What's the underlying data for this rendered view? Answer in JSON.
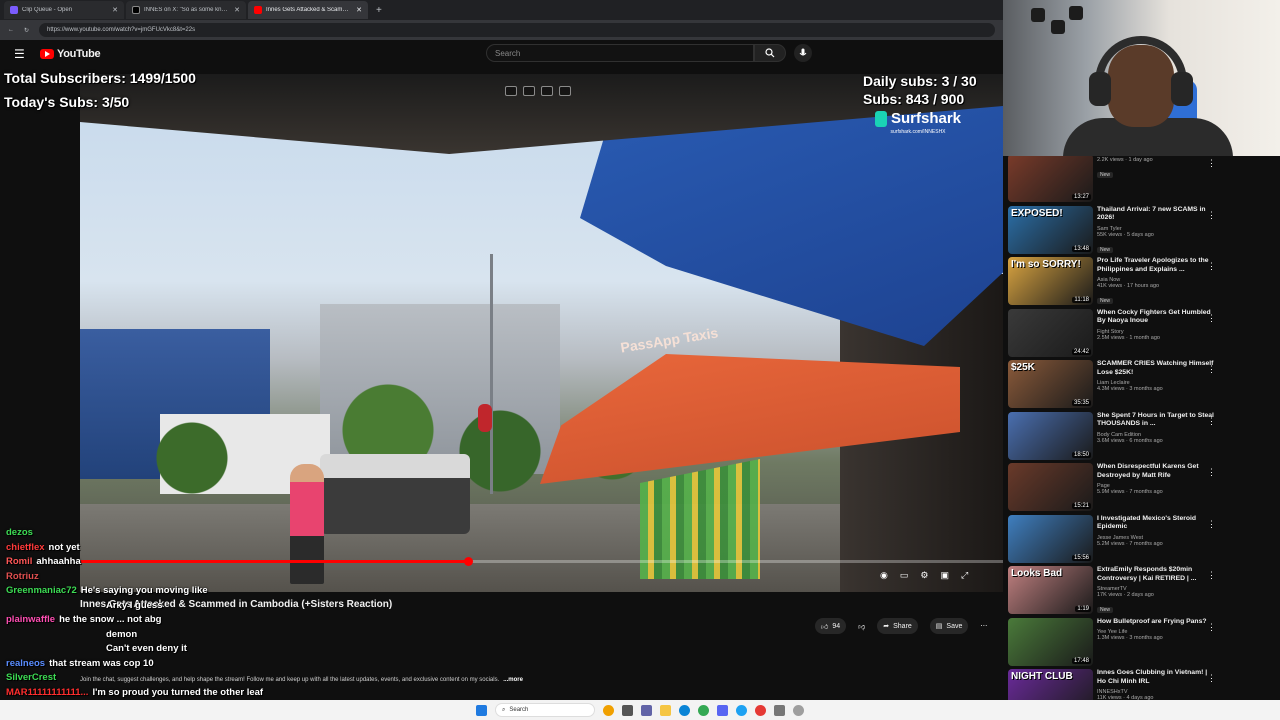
{
  "browser": {
    "tabs": [
      {
        "label": "Clip Queue - Open",
        "color": "#7b5cff"
      },
      {
        "label": "INNES on X: \"So as some know a...",
        "color": "#000000"
      },
      {
        "label": "Innes Gets Attacked & Scamm...",
        "color": "#ff0000"
      }
    ],
    "url": "https://www.youtube.com/watch?v=jmGFUcVkc8&t=22s"
  },
  "youtube": {
    "logo": "YouTube",
    "search_placeholder": "Search"
  },
  "overlay": {
    "total_subs": "Total Subscribers: 1499/1500",
    "today_subs": "Today's Subs: 3/50",
    "daily_subs": "Daily subs: 3 / 30",
    "subs": "Subs: 843 / 900"
  },
  "sponsor": {
    "name": "Surfshark",
    "url": "surfshark.com/INNESHX"
  },
  "video": {
    "umbrella_text": "PassApp Taxis",
    "progress": 0.42,
    "title": "Innes Gets Attacked & Scammed in Cambodia (+Sisters Reaction)",
    "likes": "94",
    "share": "Share",
    "save": "Save",
    "description": "Join the chat, suggest challenges, and help shape the stream! Follow me and keep up with all the latest updates, events, and exclusive content on my socials.",
    "more": "...more"
  },
  "chat": [
    {
      "user": "dezos",
      "msg": "",
      "color": "#3ddc54"
    },
    {
      "user": "chietflex",
      "msg": "not yet",
      "color": "#ff3b3b"
    },
    {
      "user": "Romil",
      "msg": "ahhaahha",
      "color": "#ff5757"
    },
    {
      "user": "Rotriuz",
      "msg": "",
      "color": "#e05050"
    },
    {
      "user": "Greenmaniac72",
      "msg": "He's saying you moving like",
      "color": "#3ddc54"
    },
    {
      "user": "",
      "msg": "Arky I guess",
      "color": "#ffffff"
    },
    {
      "user": "plainwaffle",
      "msg": "he the snow ... not abg",
      "color": "#ff4fb3"
    },
    {
      "user": "",
      "msg": "demon",
      "color": "#ffffff"
    },
    {
      "user": "",
      "msg": "Can't even deny it",
      "color": "#ffffff"
    },
    {
      "user": "realneos",
      "msg": "that stream was cop 10",
      "color": "#5a8dff"
    },
    {
      "user": "SilverCrest",
      "msg": "",
      "color": "#3ddc54"
    },
    {
      "user": "MAR11111111111...",
      "msg": "I'm so proud you turned the other leaf",
      "color": "#ff2e2e"
    }
  ],
  "recommendations": [
    {
      "title": "",
      "channel": "",
      "stats": "2.2K views · 1 day ago",
      "dur": "13:27",
      "badge": "New",
      "thumb": "#7a3b2a",
      "ttxt": ""
    },
    {
      "title": "Thailand Arrival: 7 new SCAMS in 2026!",
      "channel": "Sam Tyler",
      "stats": "55K views · 5 days ago",
      "dur": "13:48",
      "badge": "New",
      "thumb": "#2b6fa8",
      "ttxt": "EXPOSED!"
    },
    {
      "title": "Pro Life Traveler Apologizes to the Philippines and Explains ...",
      "channel": "Asia Now",
      "stats": "41K views · 17 hours ago",
      "dur": "11:18",
      "badge": "New",
      "thumb": "#d9a441",
      "ttxt": "I'm so SORRY!"
    },
    {
      "title": "When Cocky Fighters Get Humbled By Naoya Inoue",
      "channel": "Fight Story",
      "stats": "2.5M views · 1 month ago",
      "dur": "24:42",
      "badge": "",
      "thumb": "#3a3a3a",
      "ttxt": ""
    },
    {
      "title": "SCAMMER CRIES Watching Himself Lose $25K!",
      "channel": "Liam Leclaire",
      "stats": "4.3M views · 3 months ago",
      "dur": "35:35",
      "badge": "",
      "thumb": "#8a5a3a",
      "ttxt": "$25K"
    },
    {
      "title": "She Spent 7 Hours in Target to Steal THOUSANDS in ...",
      "channel": "Body Cam Edition",
      "stats": "3.6M views · 6 months ago",
      "dur": "18:50",
      "badge": "",
      "thumb": "#4a6fb0",
      "ttxt": ""
    },
    {
      "title": "When Disrespectful Karens Get Destroyed by Matt Rife",
      "channel": "Page",
      "stats": "5.9M views · 7 months ago",
      "dur": "15:21",
      "badge": "",
      "thumb": "#6a3a2a",
      "ttxt": ""
    },
    {
      "title": "I Investigated Mexico's Steroid Epidemic",
      "channel": "Jesse James West",
      "stats": "5.2M views · 7 months ago",
      "dur": "15:56",
      "badge": "",
      "thumb": "#3f7fc0",
      "ttxt": ""
    },
    {
      "title": "ExtraEmily Responds $20min Controversy | Kai RETIRED | ...",
      "channel": "StreamerTV",
      "stats": "17K views · 2 days ago",
      "dur": "1:19",
      "badge": "New",
      "thumb": "#c08080",
      "ttxt": "Looks Bad"
    },
    {
      "title": "How Bulletproof are Frying Pans?",
      "channel": "Yee Yee Life",
      "stats": "1.3M views · 3 months ago",
      "dur": "17:48",
      "badge": "",
      "thumb": "#4a7a3a",
      "ttxt": ""
    },
    {
      "title": "Innes Goes Clubbing in Vietnam! | Ho Chi Minh IRL",
      "channel": "INNESHxTV",
      "stats": "11K views · 4 days ago",
      "dur": "11:38",
      "badge": "",
      "thumb": "#6a2a9a",
      "ttxt": "NIGHT CLUB"
    }
  ],
  "taskbar": {
    "search": "Search"
  }
}
